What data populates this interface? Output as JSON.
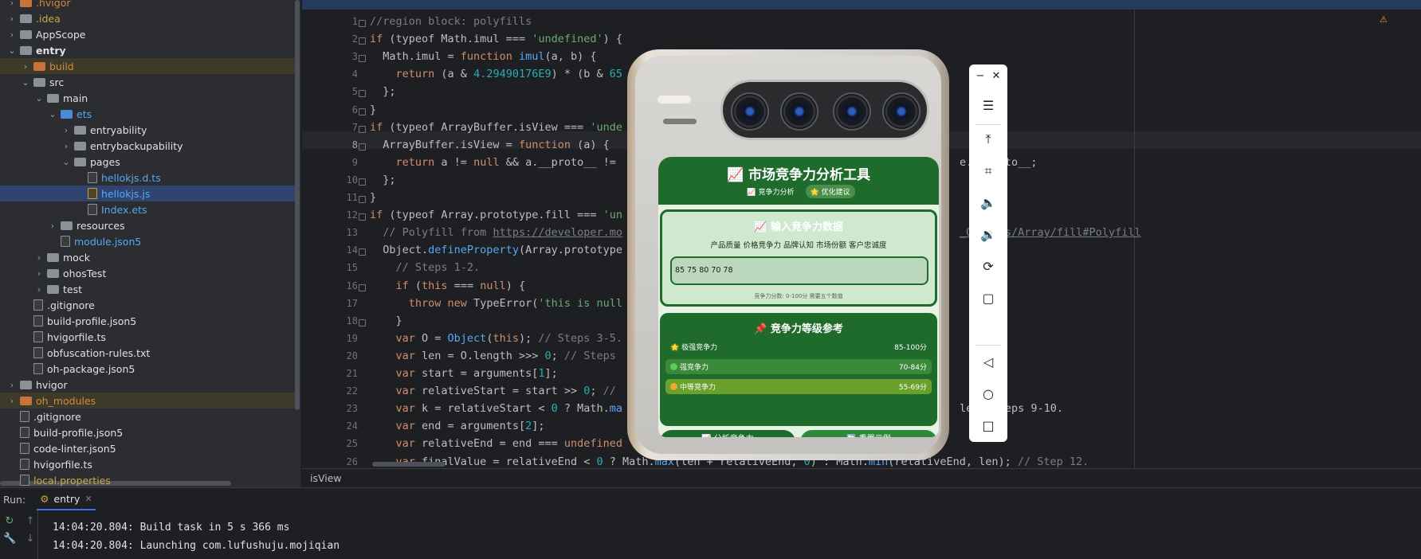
{
  "project_tree": {
    "items": [
      {
        "label": ".hvigor",
        "kind": "folder",
        "color": "orange",
        "depth": 1,
        "chev": "›"
      },
      {
        "label": ".idea",
        "kind": "folder",
        "color": "yellow-excluded",
        "depth": 1,
        "chev": "›"
      },
      {
        "label": "AppScope",
        "kind": "folder",
        "depth": 1,
        "chev": "›"
      },
      {
        "label": "entry",
        "kind": "folder",
        "depth": 1,
        "chev": "⌄",
        "bold": true
      },
      {
        "label": "build",
        "kind": "folder",
        "color": "orange",
        "depth": 2,
        "chev": "›"
      },
      {
        "label": "src",
        "kind": "folder",
        "depth": 2,
        "chev": "⌄"
      },
      {
        "label": "main",
        "kind": "folder",
        "depth": 3,
        "chev": "⌄"
      },
      {
        "label": "ets",
        "kind": "folder",
        "color": "blue",
        "depth": 4,
        "chev": "⌄"
      },
      {
        "label": "entryability",
        "kind": "folder",
        "depth": 5,
        "chev": "›"
      },
      {
        "label": "entrybackupability",
        "kind": "folder",
        "depth": 5,
        "chev": "›"
      },
      {
        "label": "pages",
        "kind": "folder",
        "depth": 5,
        "chev": "⌄"
      },
      {
        "label": "hellokjs.d.ts",
        "kind": "file",
        "color": "blue",
        "depth": 6
      },
      {
        "label": "hellokjs.js",
        "kind": "file-js",
        "color": "blue",
        "depth": 6
      },
      {
        "label": "Index.ets",
        "kind": "file",
        "color": "blue",
        "depth": 6
      },
      {
        "label": "resources",
        "kind": "folder",
        "depth": 4,
        "chev": "›"
      },
      {
        "label": "module.json5",
        "kind": "file",
        "color": "blue",
        "depth": 4
      },
      {
        "label": "mock",
        "kind": "folder",
        "depth": 3,
        "chev": "›"
      },
      {
        "label": "ohosTest",
        "kind": "folder",
        "depth": 3,
        "chev": "›"
      },
      {
        "label": "test",
        "kind": "folder",
        "depth": 3,
        "chev": "›"
      },
      {
        "label": ".gitignore",
        "kind": "file",
        "depth": 2
      },
      {
        "label": "build-profile.json5",
        "kind": "file",
        "depth": 2
      },
      {
        "label": "hvigorfile.ts",
        "kind": "file",
        "depth": 2
      },
      {
        "label": "obfuscation-rules.txt",
        "kind": "file",
        "depth": 2
      },
      {
        "label": "oh-package.json5",
        "kind": "file",
        "depth": 2
      },
      {
        "label": "hvigor",
        "kind": "folder",
        "depth": 1,
        "chev": "›"
      },
      {
        "label": "oh_modules",
        "kind": "folder",
        "color": "orange",
        "depth": 1,
        "chev": "›"
      },
      {
        "label": ".gitignore",
        "kind": "file",
        "depth": 1
      },
      {
        "label": "build-profile.json5",
        "kind": "file",
        "depth": 1
      },
      {
        "label": "code-linter.json5",
        "kind": "file",
        "depth": 1
      },
      {
        "label": "hvigorfile.ts",
        "kind": "file",
        "depth": 1
      },
      {
        "label": "local.properties",
        "kind": "file",
        "color": "yellow",
        "depth": 1
      }
    ],
    "selected": "hellokjs.js"
  },
  "editor": {
    "current_line": 8,
    "breadcrumb": "isView",
    "lines": [
      [
        [
          "c",
          "//region block: polyfills"
        ]
      ],
      [
        [
          "k",
          "if "
        ],
        [
          "t",
          "(typeof Math.imul === "
        ],
        [
          "s",
          "'undefined'"
        ],
        [
          "t",
          ") {"
        ]
      ],
      [
        [
          "t",
          "  Math.imul = "
        ],
        [
          "k",
          "function "
        ],
        [
          "f",
          "imul"
        ],
        [
          "t",
          "(a, b) {"
        ]
      ],
      [
        [
          "t",
          "    "
        ],
        [
          "k",
          "return "
        ],
        [
          "t",
          "(a & "
        ],
        [
          "n",
          "4.29490176E9"
        ],
        [
          "t",
          ") * (b & "
        ],
        [
          "n",
          "65"
        ]
      ],
      [
        [
          "t",
          "  };"
        ]
      ],
      [
        [
          "t",
          "}"
        ]
      ],
      [
        [
          "k",
          "if "
        ],
        [
          "t",
          "(typeof ArrayBuffer.isView === "
        ],
        [
          "s",
          "'unde"
        ]
      ],
      [
        [
          "t",
          "  ArrayBuffer.isView = "
        ],
        [
          "k",
          "function "
        ],
        [
          "t",
          "(a) {"
        ]
      ],
      [
        [
          "t",
          "    "
        ],
        [
          "k",
          "return "
        ],
        [
          "t",
          "a != "
        ],
        [
          "k",
          "null "
        ],
        [
          "t",
          "&& a.__proto__ != "
        ]
      ],
      [
        [
          "t",
          "  };"
        ]
      ],
      [
        [
          "t",
          "}"
        ]
      ],
      [
        [
          "k",
          "if "
        ],
        [
          "t",
          "(typeof Array.prototype.fill === "
        ],
        [
          "s",
          "'un"
        ]
      ],
      [
        [
          "c",
          "  // Polyfill from "
        ],
        [
          "u",
          "https://developer.mo"
        ]
      ],
      [
        [
          "t",
          "  Object."
        ],
        [
          "f",
          "defineProperty"
        ],
        [
          "t",
          "(Array.prototype"
        ]
      ],
      [
        [
          "c",
          "    // Steps 1-2."
        ]
      ],
      [
        [
          "t",
          "    "
        ],
        [
          "k",
          "if "
        ],
        [
          "t",
          "("
        ],
        [
          "k",
          "this "
        ],
        [
          "t",
          "=== "
        ],
        [
          "k",
          "null"
        ],
        [
          "t",
          ") {"
        ]
      ],
      [
        [
          "t",
          "      "
        ],
        [
          "k",
          "throw new "
        ],
        [
          "t",
          "TypeError("
        ],
        [
          "s",
          "'this is null"
        ]
      ],
      [
        [
          "t",
          "    }"
        ]
      ],
      [
        [
          "t",
          "    "
        ],
        [
          "k",
          "var "
        ],
        [
          "t",
          "O = "
        ],
        [
          "f",
          "Object"
        ],
        [
          "t",
          "("
        ],
        [
          "k",
          "this"
        ],
        [
          "t",
          "); "
        ],
        [
          "c",
          "// Steps 3-5."
        ]
      ],
      [
        [
          "t",
          "    "
        ],
        [
          "k",
          "var "
        ],
        [
          "t",
          "len = O.length >>> "
        ],
        [
          "n",
          "0"
        ],
        [
          "t",
          "; "
        ],
        [
          "c",
          "// Steps"
        ]
      ],
      [
        [
          "t",
          "    "
        ],
        [
          "k",
          "var "
        ],
        [
          "t",
          "start = arguments["
        ],
        [
          "n",
          "1"
        ],
        [
          "t",
          "];"
        ]
      ],
      [
        [
          "t",
          "    "
        ],
        [
          "k",
          "var "
        ],
        [
          "t",
          "relativeStart = start >> "
        ],
        [
          "n",
          "0"
        ],
        [
          "t",
          "; "
        ],
        [
          "c",
          "//"
        ]
      ],
      [
        [
          "t",
          "    "
        ],
        [
          "k",
          "var "
        ],
        [
          "t",
          "k = relativeStart < "
        ],
        [
          "n",
          "0"
        ],
        [
          "t",
          " ? Math."
        ],
        [
          "f",
          "ma"
        ]
      ],
      [
        [
          "t",
          "    "
        ],
        [
          "k",
          "var "
        ],
        [
          "t",
          "end = arguments["
        ],
        [
          "n",
          "2"
        ],
        [
          "t",
          "];"
        ]
      ],
      [
        [
          "t",
          "    "
        ],
        [
          "k",
          "var "
        ],
        [
          "t",
          "relativeEnd = end === "
        ],
        [
          "k",
          "undefined"
        ]
      ],
      [
        [
          "t",
          "    "
        ],
        [
          "k",
          "var "
        ],
        [
          "t",
          "finalValue = relativeEnd < "
        ],
        [
          "n",
          "0"
        ],
        [
          "t",
          " ? Math."
        ],
        [
          "f",
          "max"
        ],
        [
          "t",
          "(len + relativeEnd, "
        ],
        [
          "n",
          "0"
        ],
        [
          "t",
          ") : Math."
        ],
        [
          "f",
          "min"
        ],
        [
          "t",
          "(relativeEnd, len); "
        ],
        [
          "c",
          "// Step 12."
        ]
      ]
    ],
    "right_fragments": [
      {
        "line": 9,
        "text": "e.__proto__;"
      },
      {
        "line": 13,
        "text": "_Objects/Array/fill#Polyfill"
      },
      {
        "line": 23,
        "text": "len  Steps 9-10."
      }
    ]
  },
  "run_panel": {
    "label": "Run:",
    "tab": "entry",
    "output": [
      "14:04:20.804: Build task in 5 s 366 ms",
      "14:04:20.804: Launching com.lufushuju.mojiqian"
    ]
  },
  "app": {
    "title": "📈 市场竞争力分析工具",
    "chips": [
      "📈 竞争力分析",
      "🌟 优化建议"
    ],
    "input_card": {
      "title": "📈 输入竞争力数据",
      "subtitle": "产品质量 价格竞争力 品牌认知 市场份额 客户忠诚度",
      "value": "85 75 80 70 78",
      "hint": "竞争力分数: 0-100分 需要五个数值"
    },
    "ref_card": {
      "title": "📌 竞争力等级参考",
      "levels": [
        {
          "name": "🌟 极强竞争力",
          "range": "85-100分",
          "color": "#1f6b2b",
          "dot": ""
        },
        {
          "name": "强竞争力",
          "range": "70-84分",
          "color": "#3a8a3a",
          "dot": "#5ec95e"
        },
        {
          "name": "中等竞争力",
          "range": "55-69分",
          "color": "#6aa12c",
          "dot": "#f0a830"
        }
      ]
    },
    "buttons": {
      "analyze": "📈 分析竞争力",
      "reset": "🔄 重置示例"
    }
  },
  "emulator_toolbar": {
    "minimize": "−",
    "close": "✕",
    "items": [
      "menu-icon",
      "top-icon",
      "crop-icon",
      "volume-up-icon",
      "volume-down-icon",
      "rotate-icon",
      "square-icon",
      "back-icon",
      "home-icon",
      "recents-icon"
    ]
  }
}
